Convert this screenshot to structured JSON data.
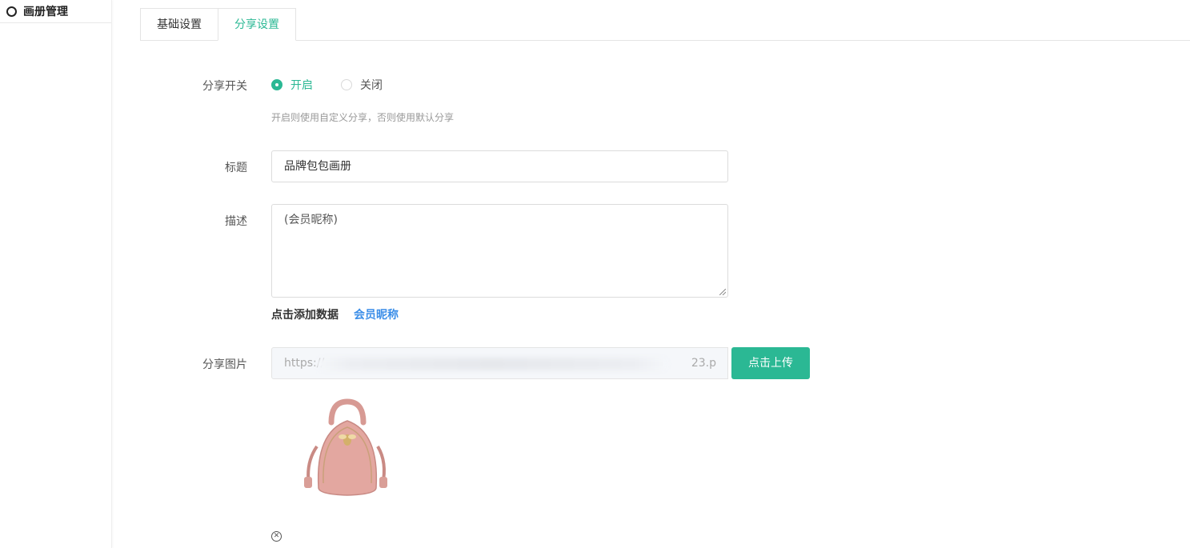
{
  "sidebar": {
    "items": [
      {
        "label": "画册管理",
        "icon": "circle-icon"
      }
    ]
  },
  "tabs": [
    {
      "label": "基础设置",
      "active": false
    },
    {
      "label": "分享设置",
      "active": true
    }
  ],
  "form": {
    "share_switch": {
      "label": "分享开关",
      "options": [
        {
          "label": "开启",
          "selected": true
        },
        {
          "label": "关闭",
          "selected": false
        }
      ],
      "hint": "开启则使用自定义分享，否则使用默认分享"
    },
    "title": {
      "label": "标题",
      "value": "品牌包包画册"
    },
    "description": {
      "label": "描述",
      "value": "(会员昵称)",
      "add_data_label": "点击添加数据",
      "add_data_link": "会员昵称"
    },
    "share_image": {
      "label": "分享图片",
      "url_prefix": "https://",
      "url_suffix": "23.p",
      "upload_label": "点击上传",
      "image_desc": "pink-backpack-image"
    }
  },
  "colors": {
    "accent": "#2bb894",
    "link": "#3b8ee8"
  }
}
